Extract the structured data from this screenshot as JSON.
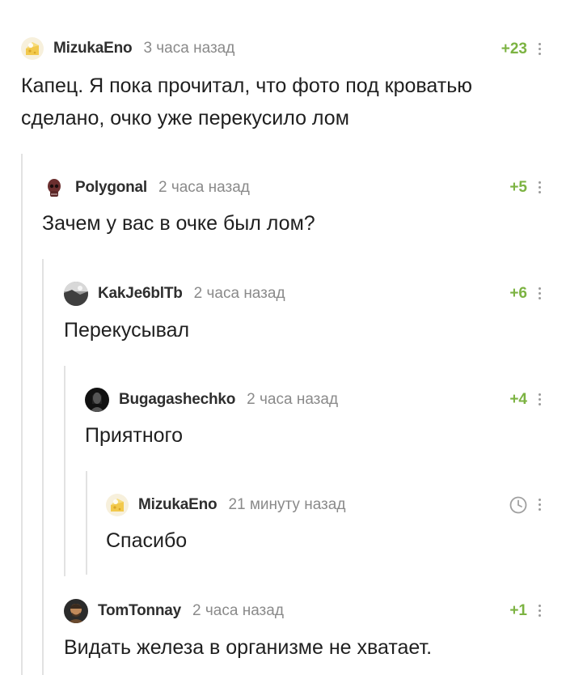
{
  "comments": [
    {
      "username": "MizukaEno",
      "time": "3 часа назад",
      "rating": "+23",
      "text": "Капец. Я пока прочитал, что фото под кроватью сделано, очко уже перекусило лом",
      "avatar": "cheese-cat-avatar"
    },
    {
      "username": "Polygonal",
      "time": "2 часа назад",
      "rating": "+5",
      "text": "Зачем у вас в очке был лом?",
      "avatar": "skull-avatar"
    },
    {
      "username": "KakJe6blTb",
      "time": "2 часа назад",
      "rating": "+6",
      "text": "Перекусывал",
      "avatar": "photo-avatar"
    },
    {
      "username": "Bugagashechko",
      "time": "2 часа назад",
      "rating": "+4",
      "text": "Приятного",
      "avatar": "dark-portrait-avatar"
    },
    {
      "username": "MizukaEno",
      "time": "21 минуту назад",
      "rating_icon": "clock-icon",
      "text": "Спасибо",
      "avatar": "cheese-cat-avatar"
    },
    {
      "username": "TomTonnay",
      "time": "2 часа назад",
      "rating": "+1",
      "text": "Видать железа в организме не хватает.",
      "avatar": "man-portrait-avatar"
    }
  ],
  "colors": {
    "rating_positive": "#7cb342",
    "thread_line": "#e2e2e2",
    "meta_text": "#8a8a8a"
  }
}
